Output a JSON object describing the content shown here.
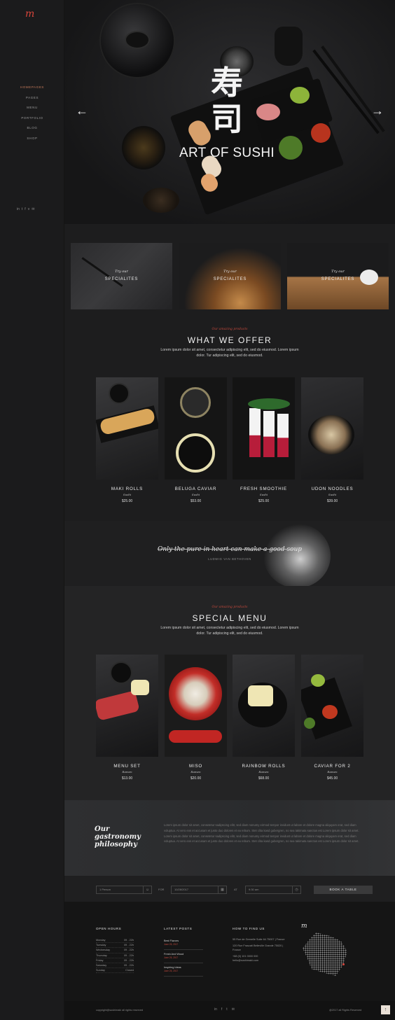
{
  "brand": {
    "logo": "m",
    "accent": "#d8453b"
  },
  "nav": [
    "HOMEPAGES",
    "PAGES",
    "MENU",
    "PORTFOLIO",
    "BLOG",
    "SHOP"
  ],
  "nav_active_index": 0,
  "sidebar_social": [
    "in",
    "t",
    "f",
    "v",
    "✉"
  ],
  "hero": {
    "kanji_1": "寿",
    "kanji_2": "司",
    "title": "ART OF SUSHI",
    "prev": "←",
    "next": "→"
  },
  "specialites": [
    {
      "kicker": "Try our",
      "label": "SPECIALITES"
    },
    {
      "kicker": "Try our",
      "label": "SPECIALITES"
    },
    {
      "kicker": "Try our",
      "label": "SPECIALITES"
    }
  ],
  "offer": {
    "kicker": "Our amazing products",
    "title": "WHAT WE OFFER",
    "text": "Lorem ipsum dolor sit amet, consectetur adipiscing elit, sed do eiusmod. Lorem ipsum dolor. Tur adipiscing elit, sed do eiusmod.",
    "items": [
      {
        "name": "MAKI ROLLS",
        "cat": "Sushi",
        "price": "$25.00"
      },
      {
        "name": "BELUGA CAVIAR",
        "cat": "Sushi",
        "price": "$53.00"
      },
      {
        "name": "FRESH SMOOTHIE",
        "cat": "Sushi",
        "price": "$25.00"
      },
      {
        "name": "UDON NOODLES",
        "cat": "Sushi",
        "price": "$39.00"
      }
    ]
  },
  "quote": {
    "text": "Only the pure in heart can make a good soup",
    "author": "LUDWIG VAN BETHOVEN"
  },
  "special_menu": {
    "kicker": "Our amazing products",
    "title": "SPECIAL MENU",
    "text": "Lorem ipsum dolor sit amet, consectetur adipiscing elit, sed do eiusmod. Lorem ipsum dolor. Tur adipiscing elit, sed do eiusmod.",
    "items": [
      {
        "name": "MENU SET",
        "cat": "Ramen",
        "price": "$13.00"
      },
      {
        "name": "MISO",
        "cat": "Ramen",
        "price": "$20.00"
      },
      {
        "name": "RAINBOW ROLLS",
        "cat": "Ramen",
        "price": "$68.00"
      },
      {
        "name": "CAVIAR FOR 2",
        "cat": "Ramen",
        "price": "$45.00"
      }
    ]
  },
  "philosophy": {
    "line1": "Our",
    "line2": "gastronomy",
    "line3": "philosophy",
    "text": "Lorem ipsum dolor sit amet, consetetur sadipscing elitr, sed diam nonumy eirmod tempor invidunt ut labore et dolore magna aliquyam erat, sed diam voluptua. At vero eos et accusam et justo duo dolores et ea rebum. Stet clita kasd gubergren, no sea takimata sanctus est Lorem ipsum dolor sit amet. Lorem ipsum dolor sit amet, consetetur sadipscing elitr, sed diam nonumy eirmod tempor invidunt ut labore et dolore magna aliquyam erat, sed diam voluptua. At vero eos et accusam et justo duo dolores et ea rebum. Stet clita kasd gubergren, no sea takimata sanctus est Lorem ipsum dolor sit amet."
  },
  "booking": {
    "persons": "1 Person",
    "for_label": "FOR",
    "date": "10/28/2017",
    "at_label": "AT",
    "time": "9:30 am",
    "button": "BOOK A TABLE"
  },
  "footer": {
    "hours_title": "OPEN HOURS",
    "hours": [
      {
        "day": "Monday",
        "time": "09 - 22h"
      },
      {
        "day": "Tuesday",
        "time": "09 - 22h"
      },
      {
        "day": "Wednesday",
        "time": "09 - 22h"
      },
      {
        "day": "Thursday",
        "time": "09 - 22h"
      },
      {
        "day": "Friday",
        "time": "09 - 22h"
      },
      {
        "day": "Saturday",
        "time": "09 - 22h"
      },
      {
        "day": "Sunday",
        "time": "Closed"
      }
    ],
    "posts_title": "LATEST POSTS",
    "posts": [
      {
        "title": "Best Flavors",
        "date": "June 25, 2017"
      },
      {
        "title": "Fresh And Wood",
        "date": "June 25, 2017"
      },
      {
        "title": "Inspiring Ideas",
        "date": "June 25, 2017"
      }
    ],
    "find_title": "HOW TO FIND US",
    "address1": "55 Rue de Grenelle Suite 64 75007 | France",
    "address2": "120 Rue Frascati Belleville Grande 75020 | France",
    "phone": "+88 (0) 101 0000 000",
    "email": "hello@sushimaki.com",
    "logo": "m",
    "copyright": "copyright@sushimaki all rights reserved",
    "copyright_right": "@2017 all Rights Reserved",
    "social": [
      "in",
      "f",
      "t",
      "✉"
    ],
    "to_top": "↑"
  }
}
